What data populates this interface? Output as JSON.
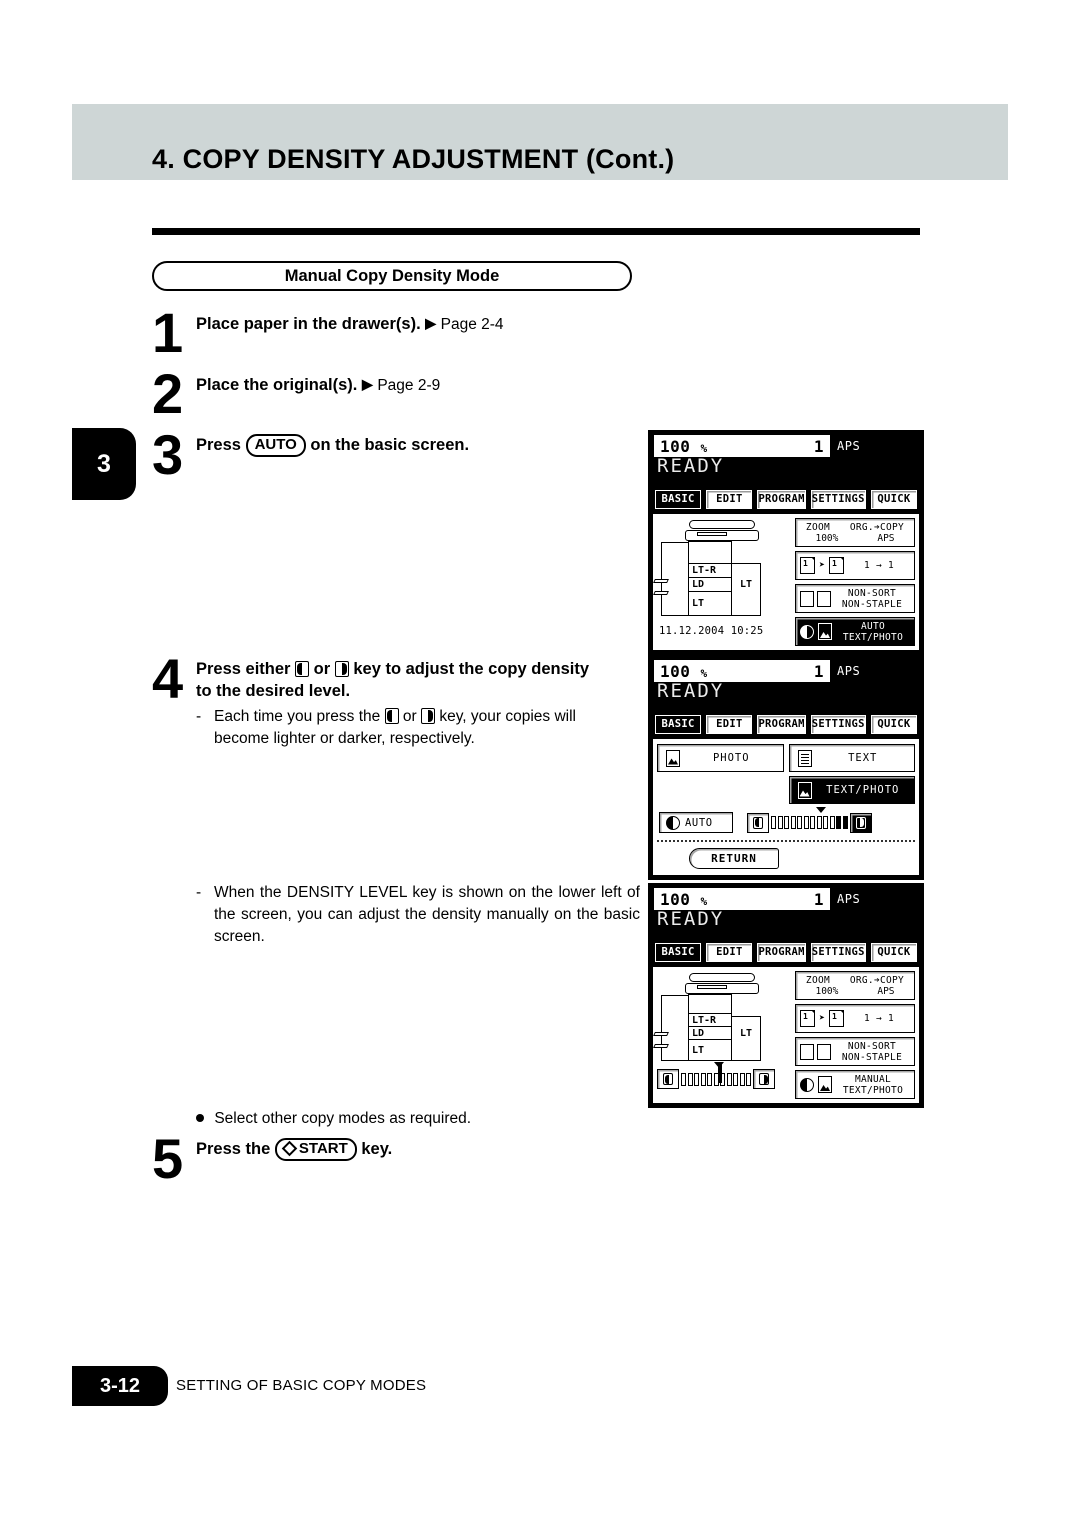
{
  "header": {
    "title": "4. COPY DENSITY ADJUSTMENT (Cont.)"
  },
  "section": {
    "label": "Manual Copy Density Mode"
  },
  "chapter_tab": {
    "number": "3"
  },
  "steps": [
    {
      "num": "1",
      "text": "Place paper in the drawer(s).",
      "pageref": "Page 2-4"
    },
    {
      "num": "2",
      "text": "Place the original(s).",
      "pageref": "Page 2-9"
    },
    {
      "num": "3",
      "text_before": "Press",
      "key": "AUTO",
      "text_after": "on the basic screen."
    },
    {
      "num": "4",
      "line1_a": "Press either",
      "line1_b": "or",
      "line1_c": "key to adjust the copy density",
      "line2": "to the desired level."
    },
    {
      "num": "5",
      "text_before": "Press the",
      "key": "START",
      "text_after": "key."
    }
  ],
  "notes": {
    "step4_note_a": "Each time you press the",
    "step4_note_b": "or",
    "step4_note_c": "key, your copies will",
    "step4_note_d": "become lighter or darker, respectively.",
    "density_level_note": "When the DENSITY LEVEL key is shown on the lower left of the screen, you can adjust the density manually on the basic screen.",
    "select_other_modes": "Select other copy modes as required."
  },
  "lcd_common": {
    "zoom_value": "100",
    "percent": "%",
    "copies": "1",
    "paper_mode": "APS",
    "status": "READY",
    "tabs": [
      {
        "label": "BASIC",
        "active": true
      },
      {
        "label": "EDIT",
        "active": false
      },
      {
        "label": "PROGRAM",
        "active": false
      },
      {
        "label": "SETTINGS",
        "active": false
      },
      {
        "label": "QUICK",
        "active": false
      }
    ],
    "drawers": {
      "d1": "LT-R",
      "d2": "LD",
      "d3": "LT",
      "bypass": "LT"
    },
    "datetime": "11.12.2004 10:25",
    "zoom_btn": {
      "label": "ZOOM",
      "value": "100%",
      "org": "ORG.",
      "arrow": "➔",
      "copy": "COPY",
      "mode": "APS"
    },
    "duplex_btn": {
      "label": "1 → 1"
    },
    "finisher_btn": {
      "line1": "NON-SORT",
      "line2": "NON-STAPLE"
    }
  },
  "lcd_panel1": {
    "density_btn": {
      "line1": "AUTO",
      "line2": "TEXT/PHOTO"
    }
  },
  "lcd_panel2": {
    "photo_label": "PHOTO",
    "text_label": "TEXT",
    "textphoto_label": "TEXT/PHOTO",
    "auto_label": "AUTO",
    "return_label": "RETURN",
    "slider_ticks": 12,
    "slider_filled_from": 10,
    "slider_marker_index": 6
  },
  "lcd_panel3": {
    "density_btn": {
      "line1": "MANUAL",
      "line2": "TEXT/PHOTO"
    },
    "slider_ticks": 11,
    "slider_marker_index": 5
  },
  "footer": {
    "page": "3-12",
    "section": "SETTING OF BASIC COPY MODES"
  },
  "colors": {
    "header_band": "#ced6d6",
    "ink": "#000000",
    "paper": "#ffffff"
  }
}
